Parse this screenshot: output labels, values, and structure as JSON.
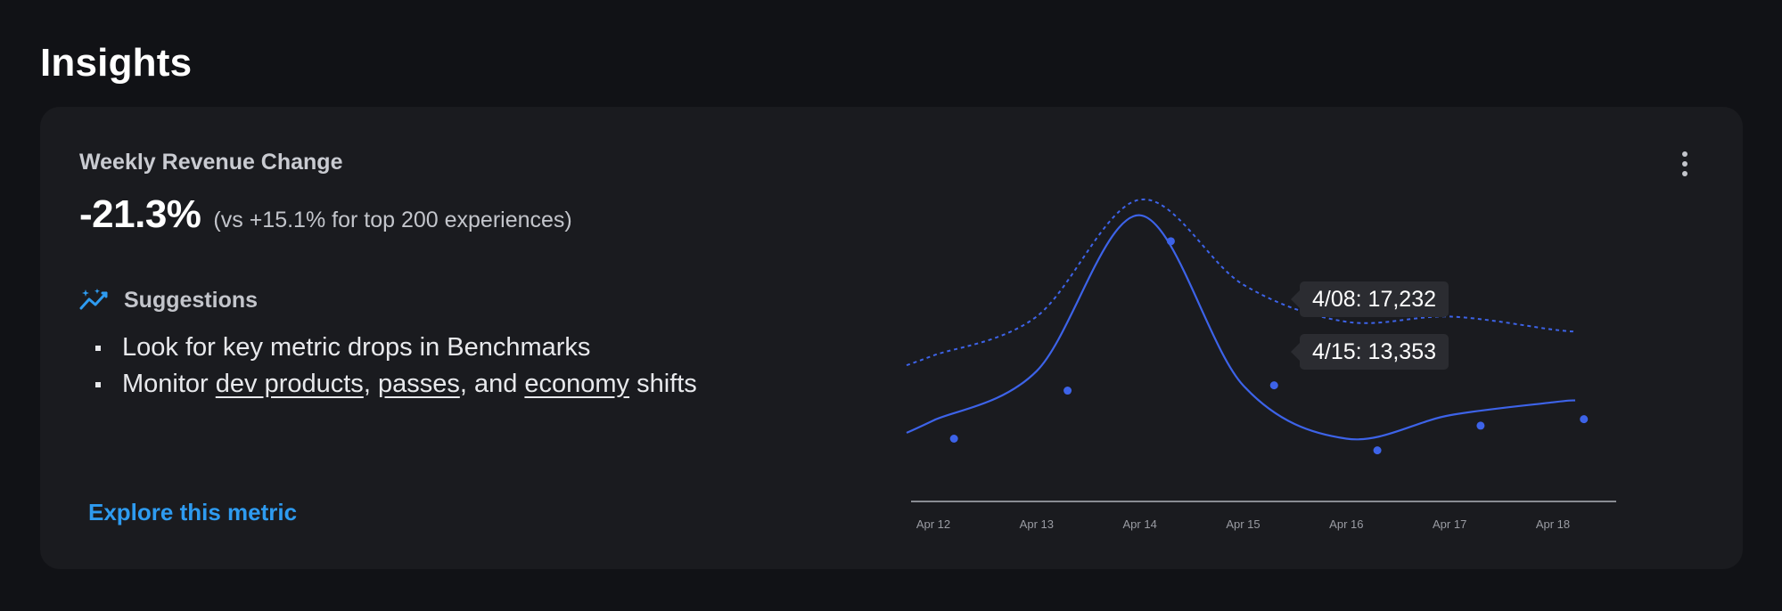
{
  "page": {
    "title": "Insights"
  },
  "card": {
    "metric_title": "Weekly Revenue Change",
    "metric_value": "-21.3%",
    "metric_compare": "(vs +15.1% for top 200 experiences)",
    "suggestions_label": "Suggestions",
    "suggestion_1": "Look for key metric drops in Benchmarks",
    "suggestion_2": {
      "prefix": "Monitor ",
      "link_1": "dev products",
      "sep_1": ", ",
      "link_2": "passes",
      "sep_2": ", and ",
      "link_3": "economy",
      "suffix": " shifts"
    },
    "explore_link": "Explore this metric",
    "menu_icon": "more-vertical-icon",
    "suggestions_icon": "trend-sparkle-icon"
  },
  "colors": {
    "accent_line": "#3d63e8",
    "link": "#2e9bf0",
    "axis": "#8a8c93"
  },
  "chart_data": {
    "type": "line",
    "categories": [
      "Apr 12",
      "Apr 13",
      "Apr 14",
      "Apr 15",
      "Apr 16",
      "Apr 17",
      "Apr 18"
    ],
    "series": [
      {
        "style": "solid",
        "values": [
          12000,
          13900,
          19900,
          13353,
          11300,
          12200,
          12700
        ]
      },
      {
        "style": "dotted",
        "values": [
          14500,
          16000,
          20500,
          17232,
          15800,
          16000,
          15500
        ]
      }
    ],
    "point_markers": [
      {
        "x": 12.2,
        "y": 11300
      },
      {
        "x": 13.3,
        "y": 13150
      },
      {
        "x": 14.3,
        "y": 18900
      },
      {
        "x": 15.3,
        "y": 13353
      },
      {
        "x": 16.3,
        "y": 10850
      },
      {
        "x": 17.3,
        "y": 11800
      },
      {
        "x": 18.3,
        "y": 12050
      }
    ],
    "tooltips": [
      {
        "label": "4/08: 17,232"
      },
      {
        "label": "4/15: 13,353"
      }
    ],
    "ylim": [
      9500,
      21500
    ],
    "grid": false
  }
}
